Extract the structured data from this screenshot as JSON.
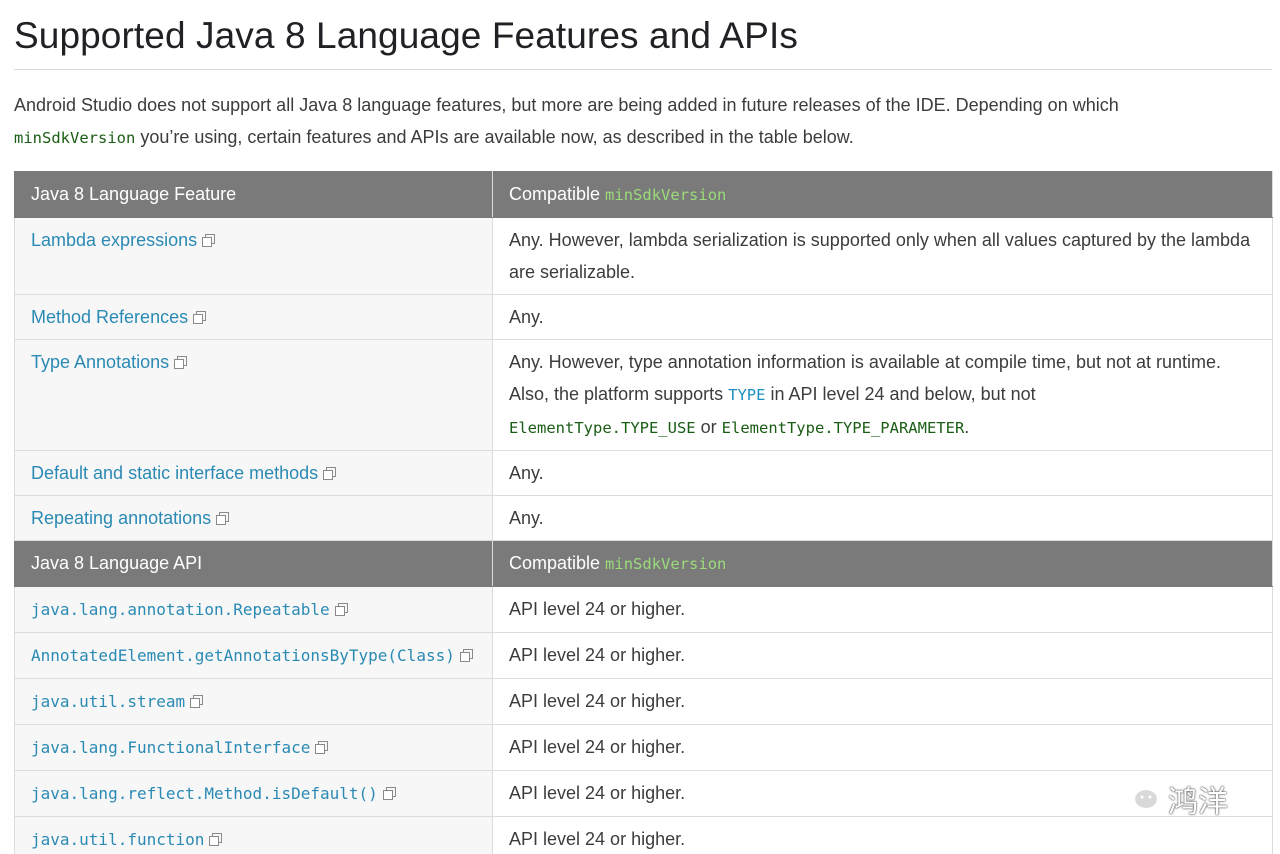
{
  "title": "Supported Java 8 Language Features and APIs",
  "intro": {
    "part1": "Android Studio does not support all Java 8 language features, but more are being added in future releases of the IDE. Depending on which",
    "code": "minSdkVersion",
    "part2": " you’re using, certain features and APIs are available now, as described in the table below."
  },
  "features_header": {
    "col1": "Java 8 Language Feature",
    "col2_text": "Compatible ",
    "col2_code": "minSdkVersion"
  },
  "features": [
    {
      "name": "Lambda expressions",
      "desc": "Any. However, lambda serialization is supported only when all values captured by the lambda are serializable."
    },
    {
      "name": "Method References",
      "desc": "Any."
    },
    {
      "name": "Type Annotations",
      "desc_part1": "Any. However, type annotation information is available at compile time, but not at runtime. Also, the platform supports ",
      "desc_code1": "TYPE",
      "desc_part2": " in API level 24 and below, but not ",
      "desc_code2": "ElementType.TYPE_USE",
      "desc_part3": " or ",
      "desc_code3": "ElementType.TYPE_PARAMETER",
      "desc_part4": "."
    },
    {
      "name": "Default and static interface methods",
      "desc": "Any."
    },
    {
      "name": "Repeating annotations",
      "desc": "Any."
    }
  ],
  "api_header": {
    "col1": "Java 8 Language API",
    "col2_text": "Compatible ",
    "col2_code": "minSdkVersion"
  },
  "apis": [
    {
      "name": "java.lang.annotation.Repeatable",
      "desc": "API level 24 or higher."
    },
    {
      "name": "AnnotatedElement.getAnnotationsByType(Class)",
      "desc": "API level 24 or higher."
    },
    {
      "name": "java.util.stream",
      "desc": "API level 24 or higher."
    },
    {
      "name": "java.lang.FunctionalInterface",
      "desc": "API level 24 or higher."
    },
    {
      "name": "java.lang.reflect.Method.isDefault()",
      "desc": "API level 24 or higher."
    },
    {
      "name": "java.util.function",
      "desc": "API level 24 or higher."
    }
  ],
  "watermark": {
    "text": "鸿洋",
    "icon": "wechat-icon"
  },
  "icons": {
    "external_link": "external-link-icon"
  },
  "colors": {
    "link": "#2a8ab4",
    "header_bg": "#7a7a7a",
    "code_green": "#1a5d14"
  }
}
